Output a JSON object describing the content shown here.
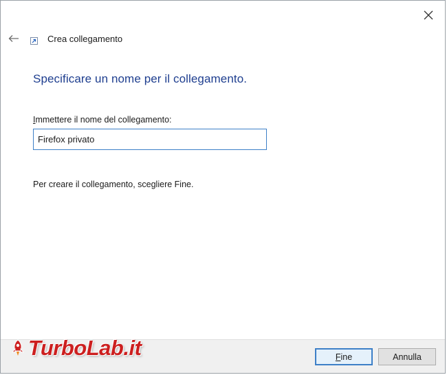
{
  "window": {
    "title": "Crea collegamento"
  },
  "page": {
    "heading": "Specificare un nome per il collegamento.",
    "field_label_accel": "I",
    "field_label_rest": "mmettere il nome del collegamento:",
    "input_value": "Firefox privato",
    "hint": "Per creare il collegamento, scegliere Fine."
  },
  "buttons": {
    "finish_accel": "F",
    "finish_rest": "ine",
    "cancel": "Annulla"
  },
  "icons": {
    "close": "close-icon",
    "back": "back-arrow-icon",
    "wizard": "shortcut-icon"
  },
  "watermark": {
    "text": "TurboLab.it"
  },
  "colors": {
    "heading": "#1e3e8f",
    "focus_border": "#3c7fc7",
    "watermark": "#cc1f1f"
  }
}
